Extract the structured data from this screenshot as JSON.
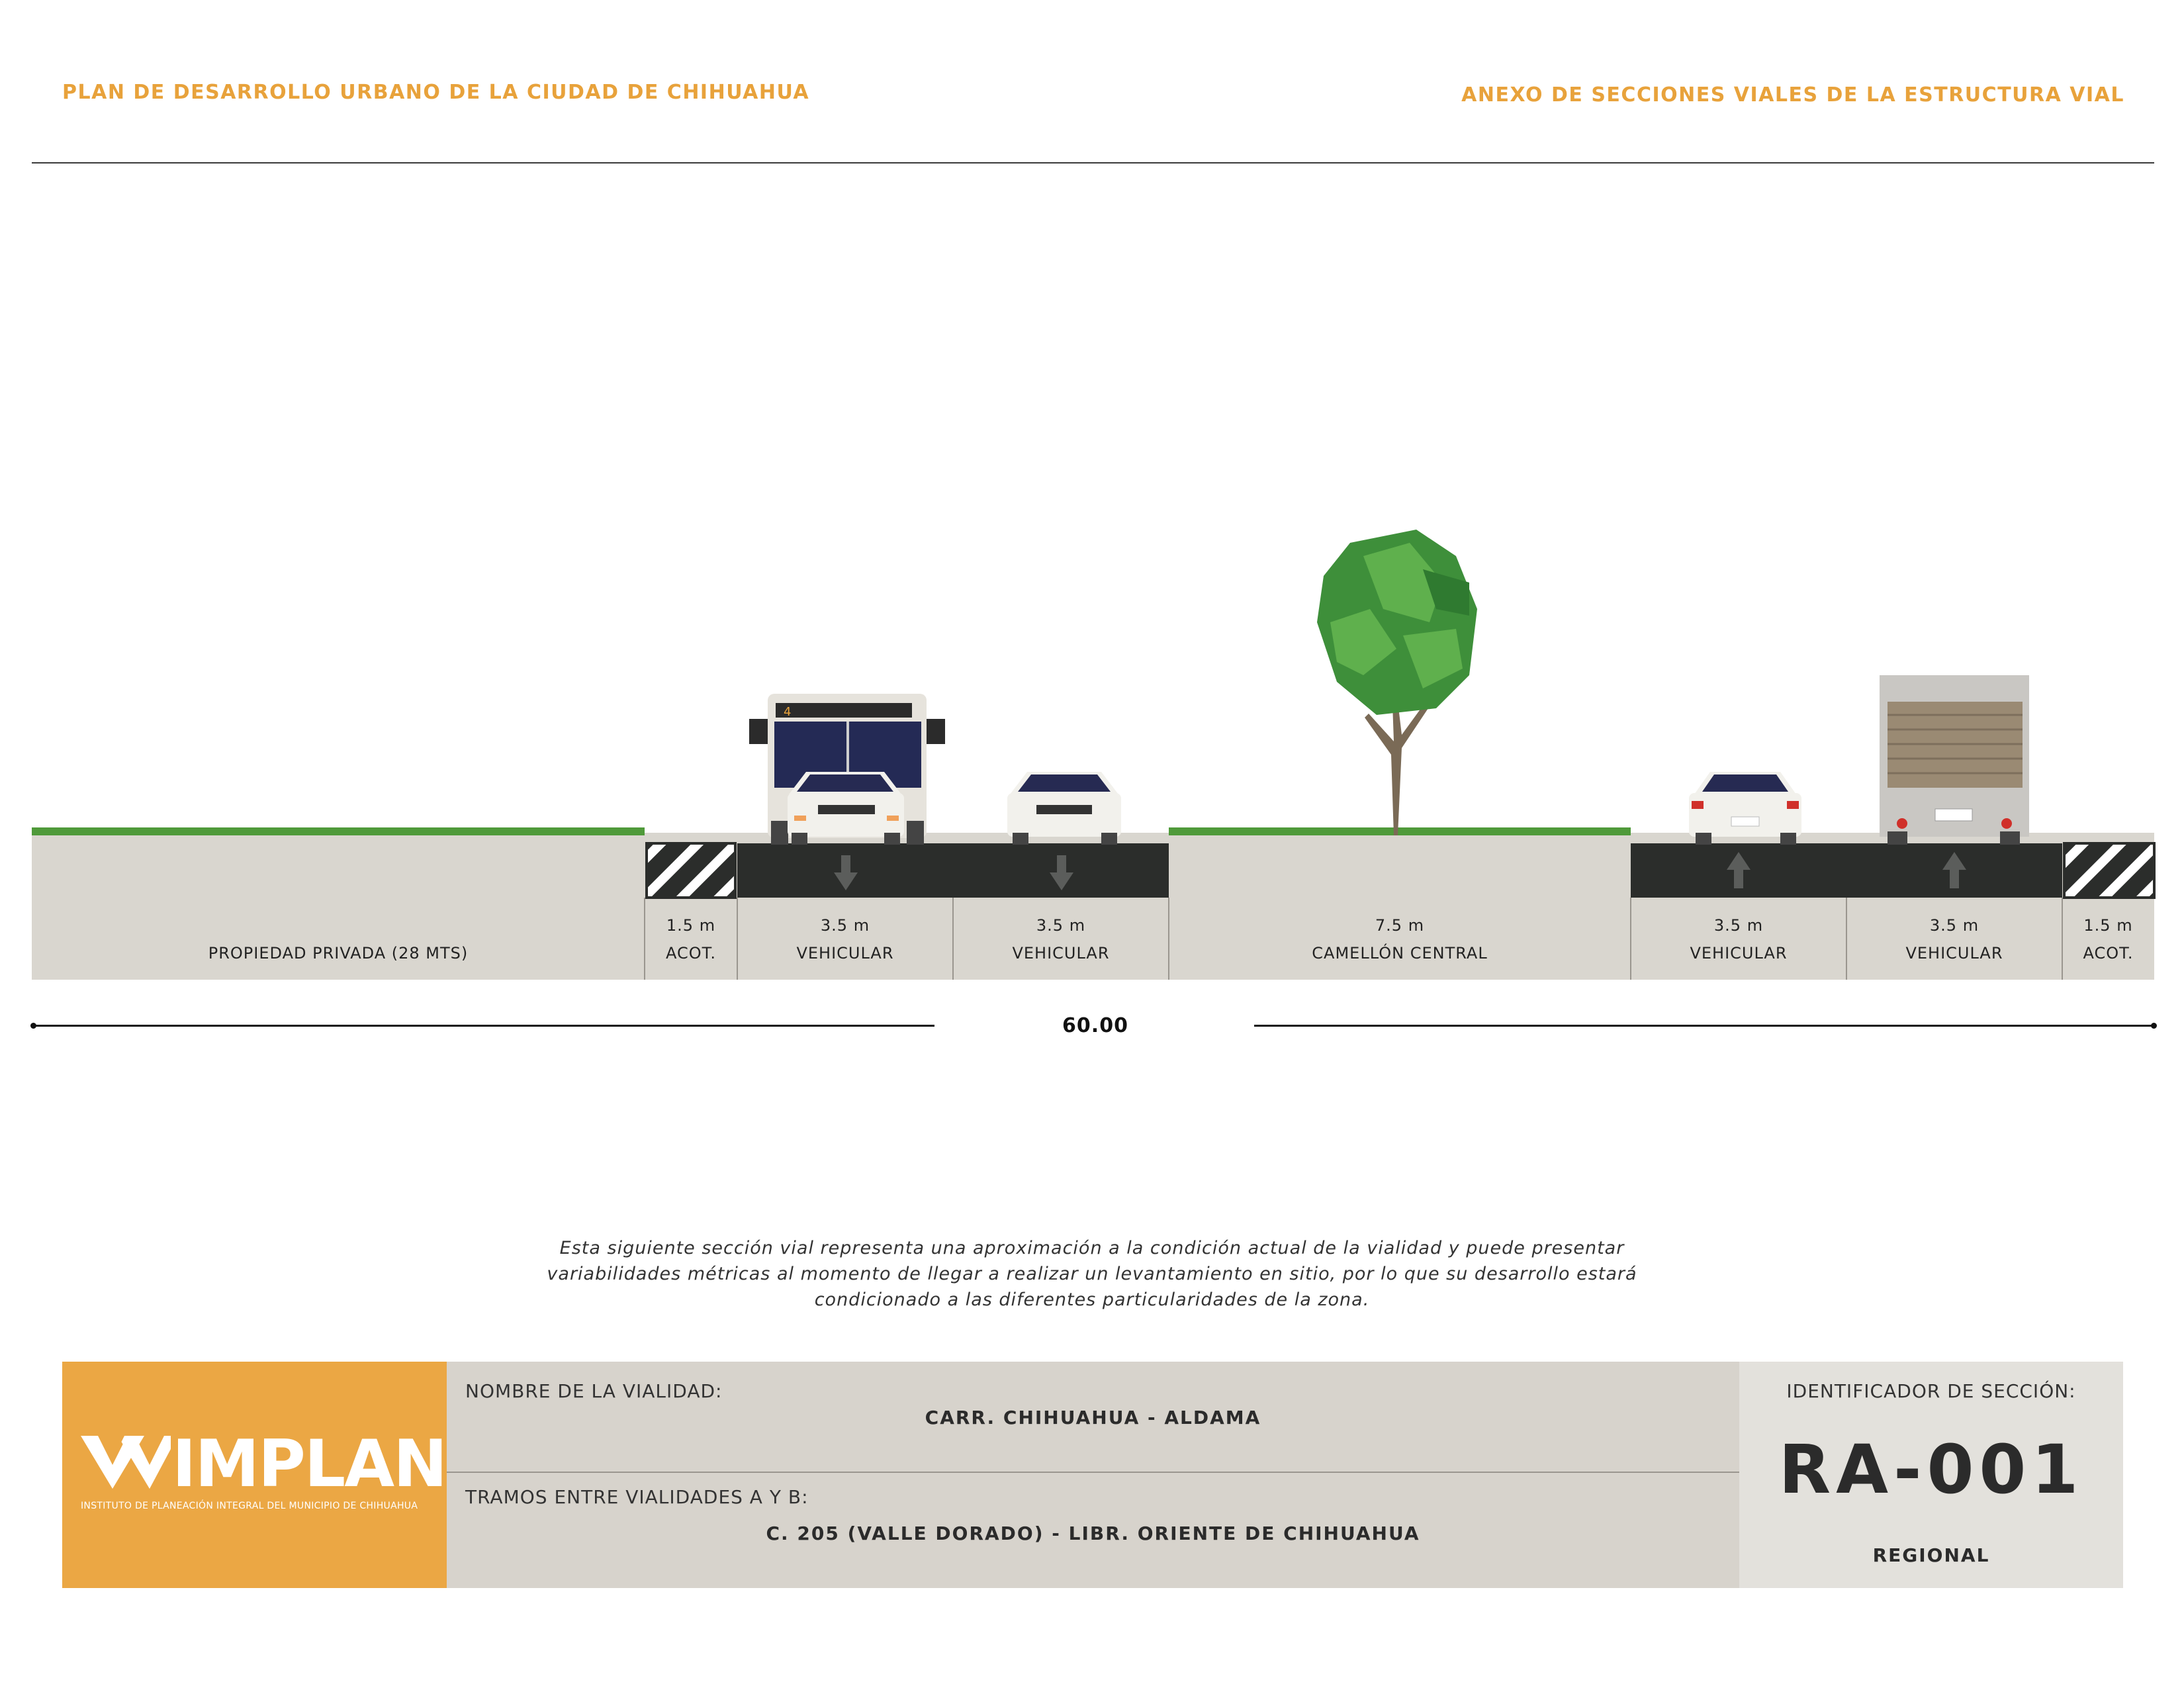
{
  "header": {
    "left_title": "PLAN DE DESARROLLO URBANO DE LA CIUDAD DE CHIHUAHUA",
    "right_title": "ANEXO DE SECCIONES VIALES DE LA ESTRUCTURA VIAL"
  },
  "section": {
    "lanes": [
      {
        "width": "",
        "name": "PROPIEDAD PRIVADA (28 MTS)"
      },
      {
        "width": "1.5 m",
        "name": "ACOT."
      },
      {
        "width": "3.5 m",
        "name": "VEHICULAR",
        "direction": "down"
      },
      {
        "width": "3.5 m",
        "name": "VEHICULAR",
        "direction": "down"
      },
      {
        "width": "7.5 m",
        "name": "CAMELLÓN CENTRAL"
      },
      {
        "width": "3.5 m",
        "name": "VEHICULAR",
        "direction": "up"
      },
      {
        "width": "3.5 m",
        "name": "VEHICULAR",
        "direction": "up"
      },
      {
        "width": "1.5 m",
        "name": "ACOT."
      }
    ],
    "total_width": "60.00",
    "bus_route_number": "4"
  },
  "disclaimer": {
    "line1": "Esta siguiente sección vial representa una aproximación a la condición actual de la vialidad y puede presentar",
    "line2": "variabilidades métricas al momento de llegar a realizar un levantamiento en sitio, por lo que su desarrollo estará",
    "line3": "condicionado a las diferentes particularidades de la zona."
  },
  "footer": {
    "logo_text": "IMPLAN",
    "logo_subtitle": "INSTITUTO DE PLANEACIÓN INTEGRAL DEL MUNICIPIO DE CHIHUAHUA",
    "name_label": "NOMBRE DE LA VIALIDAD:",
    "name_value": "CARR. CHIHUAHUA - ALDAMA",
    "tramos_label": "TRAMOS ENTRE VIALIDADES A Y B:",
    "tramos_value": "C. 205 (VALLE DORADO) - LIBR. ORIENTE DE CHIHUAHUA",
    "id_label": "IDENTIFICADOR DE SECCIÓN:",
    "id_value": "RA-001",
    "id_type": "REGIONAL"
  },
  "colors": {
    "accent": "#eba744",
    "asphalt": "#2b2d2b",
    "ground": "#d9d6cf",
    "grass": "#4f9a3a"
  }
}
